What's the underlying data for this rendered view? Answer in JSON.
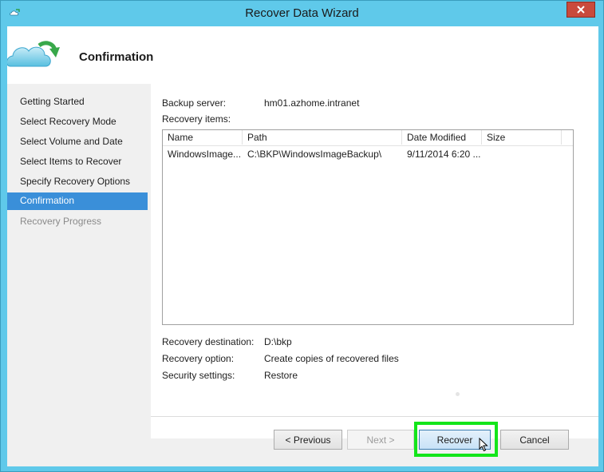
{
  "window": {
    "title": "Recover Data Wizard"
  },
  "header": {
    "title": "Confirmation"
  },
  "sidebar": {
    "items": [
      {
        "label": "Getting Started",
        "state": "normal"
      },
      {
        "label": "Select Recovery Mode",
        "state": "normal"
      },
      {
        "label": "Select Volume and Date",
        "state": "normal"
      },
      {
        "label": "Select Items to Recover",
        "state": "normal"
      },
      {
        "label": "Specify Recovery Options",
        "state": "normal"
      },
      {
        "label": "Confirmation",
        "state": "active"
      },
      {
        "label": "Recovery Progress",
        "state": "disabled"
      }
    ]
  },
  "summary": {
    "backup_server_label": "Backup server:",
    "backup_server_value": "hm01.azhome.intranet",
    "recovery_items_label": "Recovery items:",
    "recovery_destination_label": "Recovery destination:",
    "recovery_destination_value": "D:\\bkp",
    "recovery_option_label": "Recovery option:",
    "recovery_option_value": "Create copies of recovered files",
    "security_settings_label": "Security settings:",
    "security_settings_value": "Restore"
  },
  "items_table": {
    "columns": [
      "Name",
      "Path",
      "Date Modified",
      "Size"
    ],
    "rows": [
      {
        "name": "WindowsImage...",
        "path": "C:\\BKP\\WindowsImageBackup\\",
        "date_modified": "9/11/2014 6:20 ...",
        "size": ""
      }
    ]
  },
  "buttons": {
    "previous": "< Previous",
    "next": "Next >",
    "recover": "Recover",
    "cancel": "Cancel"
  },
  "colors": {
    "title_bar": "#5fc9ea",
    "active_nav": "#3a8fd9",
    "highlight": "#13e51a",
    "close_button": "#c94a3c"
  }
}
